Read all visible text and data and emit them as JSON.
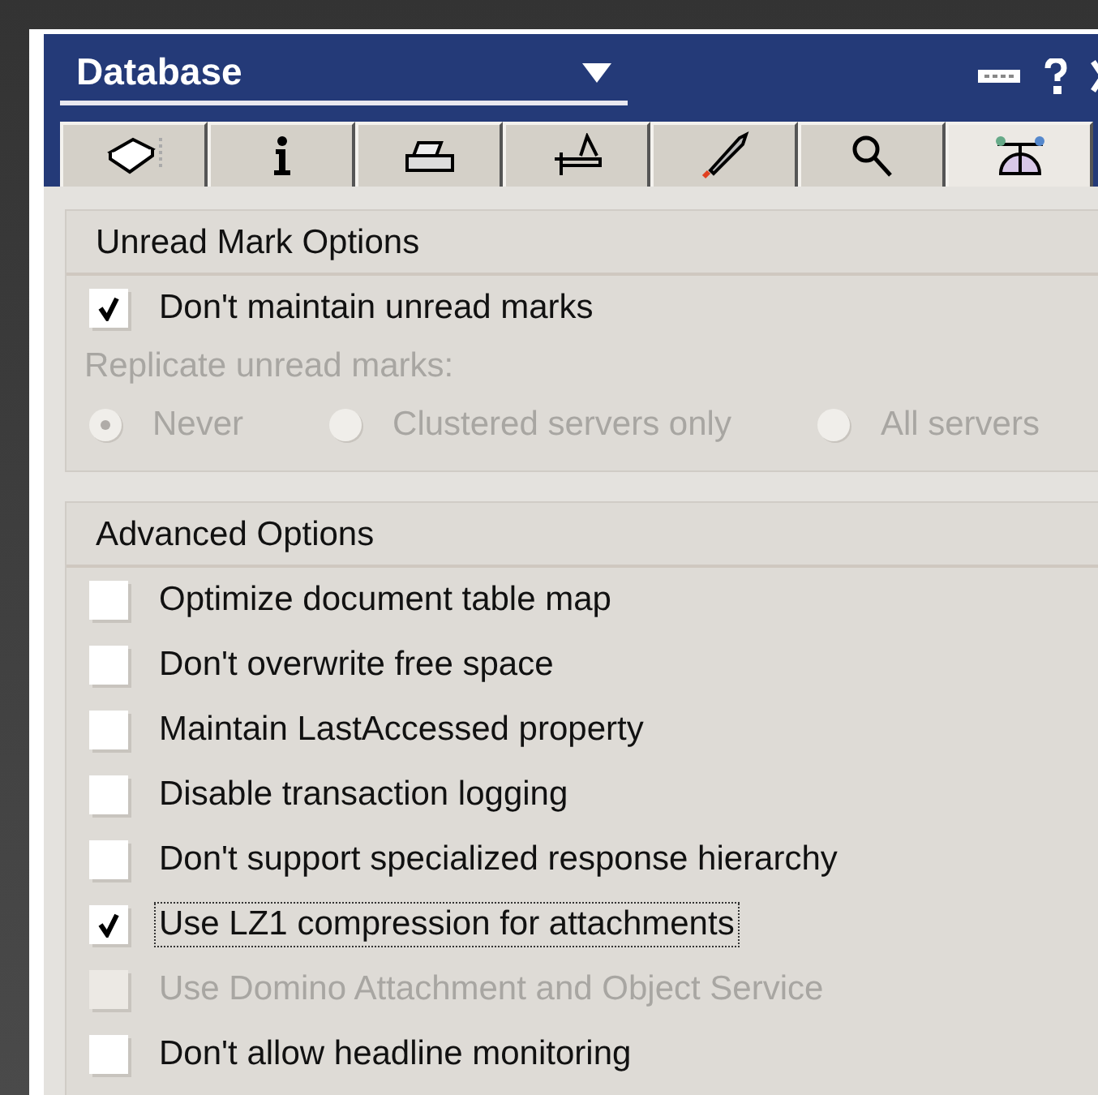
{
  "window": {
    "title": "Database"
  },
  "tabs": [
    {
      "selected": false
    },
    {
      "selected": false
    },
    {
      "selected": false
    },
    {
      "selected": false
    },
    {
      "selected": false
    },
    {
      "selected": false
    },
    {
      "selected": true
    }
  ],
  "sections": [
    {
      "header": "Unread Mark Options",
      "items": [
        {
          "kind": "checkbox",
          "label": "Don't maintain unread marks",
          "checked": true,
          "disabled": false,
          "focused": false
        },
        {
          "kind": "label",
          "label": "Replicate unread marks:",
          "disabled": true
        },
        {
          "kind": "radios",
          "disabled": true,
          "options": [
            {
              "label": "Never",
              "selected": true
            },
            {
              "label": "Clustered servers only",
              "selected": false
            },
            {
              "label": "All servers",
              "selected": false
            }
          ]
        }
      ]
    },
    {
      "header": "Advanced Options",
      "items": [
        {
          "kind": "checkbox",
          "label": "Optimize document table map",
          "checked": false,
          "disabled": false,
          "focused": false
        },
        {
          "kind": "checkbox",
          "label": "Don't overwrite free space",
          "checked": false,
          "disabled": false,
          "focused": false
        },
        {
          "kind": "checkbox",
          "label": "Maintain LastAccessed property",
          "checked": false,
          "disabled": false,
          "focused": false
        },
        {
          "kind": "checkbox",
          "label": "Disable transaction logging",
          "checked": false,
          "disabled": false,
          "focused": false
        },
        {
          "kind": "checkbox",
          "label": "Don't support specialized response hierarchy",
          "checked": false,
          "disabled": false,
          "focused": false
        },
        {
          "kind": "checkbox",
          "label": "Use LZ1 compression for attachments",
          "checked": true,
          "disabled": false,
          "focused": true
        },
        {
          "kind": "checkbox",
          "label": "Use Domino Attachment and Object Service",
          "checked": false,
          "disabled": true,
          "focused": false
        },
        {
          "kind": "checkbox",
          "label": "Don't allow headline monitoring",
          "checked": false,
          "disabled": false,
          "focused": false
        }
      ]
    }
  ]
}
